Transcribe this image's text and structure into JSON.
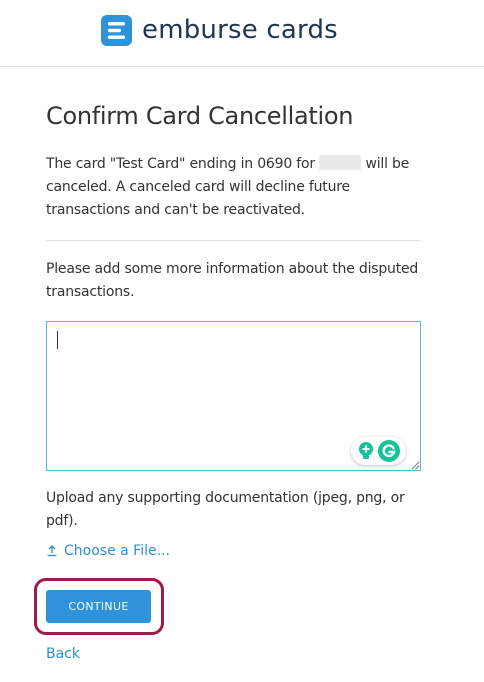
{
  "header": {
    "brand_name": "emburse cards"
  },
  "page": {
    "title": "Confirm Card Cancellation",
    "description_part1": "The card \"Test Card\" ending in 0690 for ",
    "description_part2": " will be canceled. A canceled card will decline future transactions and can't be reactivated.",
    "prompt": "Please add some more information about the disputed transactions.",
    "textarea_value": "",
    "upload_text": "Upload any supporting documentation (jpeg, png, or pdf).",
    "choose_file_label": "Choose a File...",
    "continue_label": "CONTINUE",
    "back_label": "Back"
  },
  "colors": {
    "brand_navy": "#1d3557",
    "brand_blue": "#2e93d9",
    "link_blue": "#2a8fd6",
    "highlight": "#9b1b4a",
    "focus_border": "#59b8cc"
  }
}
